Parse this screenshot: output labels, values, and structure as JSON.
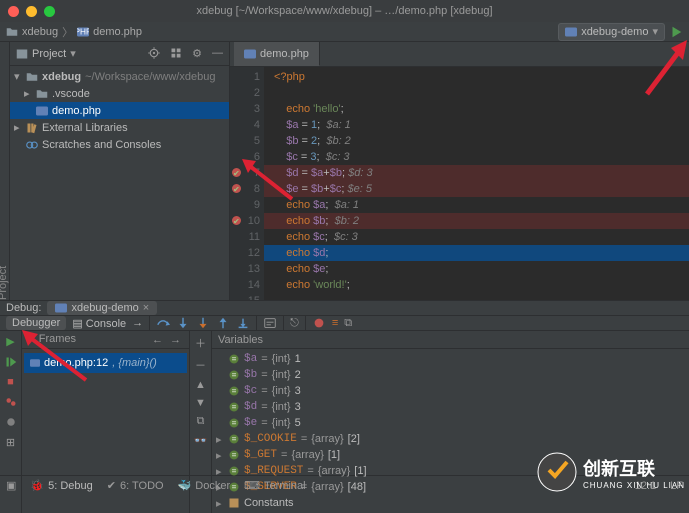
{
  "window": {
    "title": "xdebug [~/Workspace/www/xdebug] – …/demo.php [xdebug]"
  },
  "breadcrumbs": {
    "project": "xdebug",
    "file": "demo.php"
  },
  "left_vlabels": {
    "a": "Project"
  },
  "run_config": {
    "label": "xdebug-demo"
  },
  "project_panel": {
    "title": "Project",
    "root": "xdebug",
    "root_path": "~/Workspace/www/xdebug",
    "folder_vscode": ".vscode",
    "file_demo": "demo.php",
    "external_libs": "External Libraries",
    "scratches": "Scratches and Consoles"
  },
  "editor": {
    "tab_label": "demo.php",
    "lines": [
      {
        "n": 1,
        "html": "<span class='kw'>&lt;?php</span>"
      },
      {
        "n": 2,
        "html": ""
      },
      {
        "n": 3,
        "html": "    <span class='kw'>echo</span> <span class='str'>'hello'</span>;"
      },
      {
        "n": 4,
        "html": "    <span class='var'>$a</span> = <span class='num'>1</span>;  <span class='com'>$a: 1</span>"
      },
      {
        "n": 5,
        "html": "    <span class='var'>$b</span> = <span class='num'>2</span>;  <span class='com'>$b: 2</span>"
      },
      {
        "n": 6,
        "html": "    <span class='var'>$c</span> = <span class='num'>3</span>;  <span class='com'>$c: 3</span>"
      },
      {
        "n": 7,
        "bp": true,
        "html": "    <span class='var'>$d</span> = <span class='var'>$a</span>+<span class='var'>$b</span>; <span class='com'>$d: 3</span>"
      },
      {
        "n": 8,
        "bp": true,
        "html": "    <span class='var'>$e</span> = <span class='var'>$b</span>+<span class='var'>$c</span>; <span class='com'>$e: 5</span>"
      },
      {
        "n": 9,
        "html": "    <span class='kw'>echo</span> <span class='var'>$a</span>;  <span class='com'>$a: 1</span>"
      },
      {
        "n": 10,
        "bp": true,
        "html": "    <span class='kw'>echo</span> <span class='var'>$b</span>;  <span class='com'>$b: 2</span>"
      },
      {
        "n": 11,
        "html": "    <span class='kw'>echo</span> <span class='var'>$c</span>;  <span class='com'>$c: 3</span>"
      },
      {
        "n": 12,
        "current": true,
        "html": "    <span class='kw'>echo</span> <span class='var'>$d</span>;"
      },
      {
        "n": 13,
        "html": "    <span class='kw'>echo</span> <span class='var'>$e</span>;"
      },
      {
        "n": 14,
        "html": "    <span class='kw'>echo</span> <span class='str'>'world!'</span>;"
      },
      {
        "n": 15,
        "html": ""
      }
    ]
  },
  "debug": {
    "title": "Debug:",
    "tab": "xdebug-demo",
    "debugger_label": "Debugger",
    "console_label": "Console",
    "frames_title": "Frames",
    "vars_title": "Variables",
    "frame": {
      "file": "demo.php:12",
      "func": ", {main}()"
    },
    "vars": [
      {
        "name": "$a",
        "type": "{int}",
        "val": "1"
      },
      {
        "name": "$b",
        "type": "{int}",
        "val": "2"
      },
      {
        "name": "$c",
        "type": "{int}",
        "val": "3"
      },
      {
        "name": "$d",
        "type": "{int}",
        "val": "3"
      },
      {
        "name": "$e",
        "type": "{int}",
        "val": "5"
      }
    ],
    "supers": [
      {
        "name": "$_COOKIE",
        "type": "{array}",
        "count": "[2]"
      },
      {
        "name": "$_GET",
        "type": "{array}",
        "count": "[1]"
      },
      {
        "name": "$_REQUEST",
        "type": "{array}",
        "count": "[1]"
      },
      {
        "name": "$_SERVER",
        "type": "{array}",
        "count": "[48]"
      }
    ],
    "constants": "Constants"
  },
  "statusbar": {
    "run": "5: Debug",
    "todo": "6: TODO",
    "docker": "Docker",
    "terminal": "Terminal",
    "pos": "12:1",
    "eol": "LF"
  },
  "watermark": {
    "line1": "创新互联",
    "line2": "CHUANG XIN HU LIAN"
  }
}
